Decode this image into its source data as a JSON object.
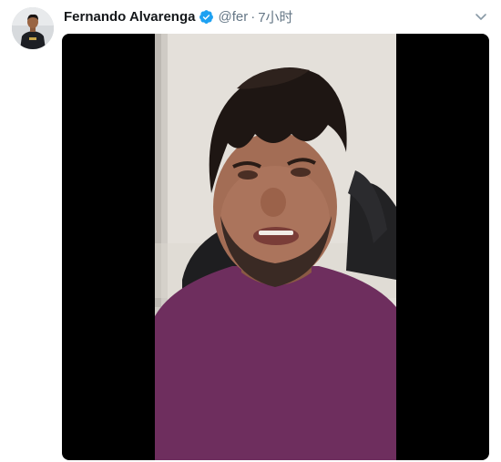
{
  "tweet": {
    "author": {
      "display_name": "Fernando Alvarenga",
      "handle": "@fer",
      "verified": true,
      "avatar_icon": "profile-photo"
    },
    "separator": "·",
    "timestamp": "7小时",
    "menu_icon": "chevron-down-icon",
    "media": {
      "type": "video",
      "content": "person-selfie-video-frame"
    }
  },
  "colors": {
    "name": "#14171a",
    "secondary": "#657786",
    "verified": "#1da1f2",
    "media_background": "#000000",
    "shirt": "#6e2e5e"
  }
}
